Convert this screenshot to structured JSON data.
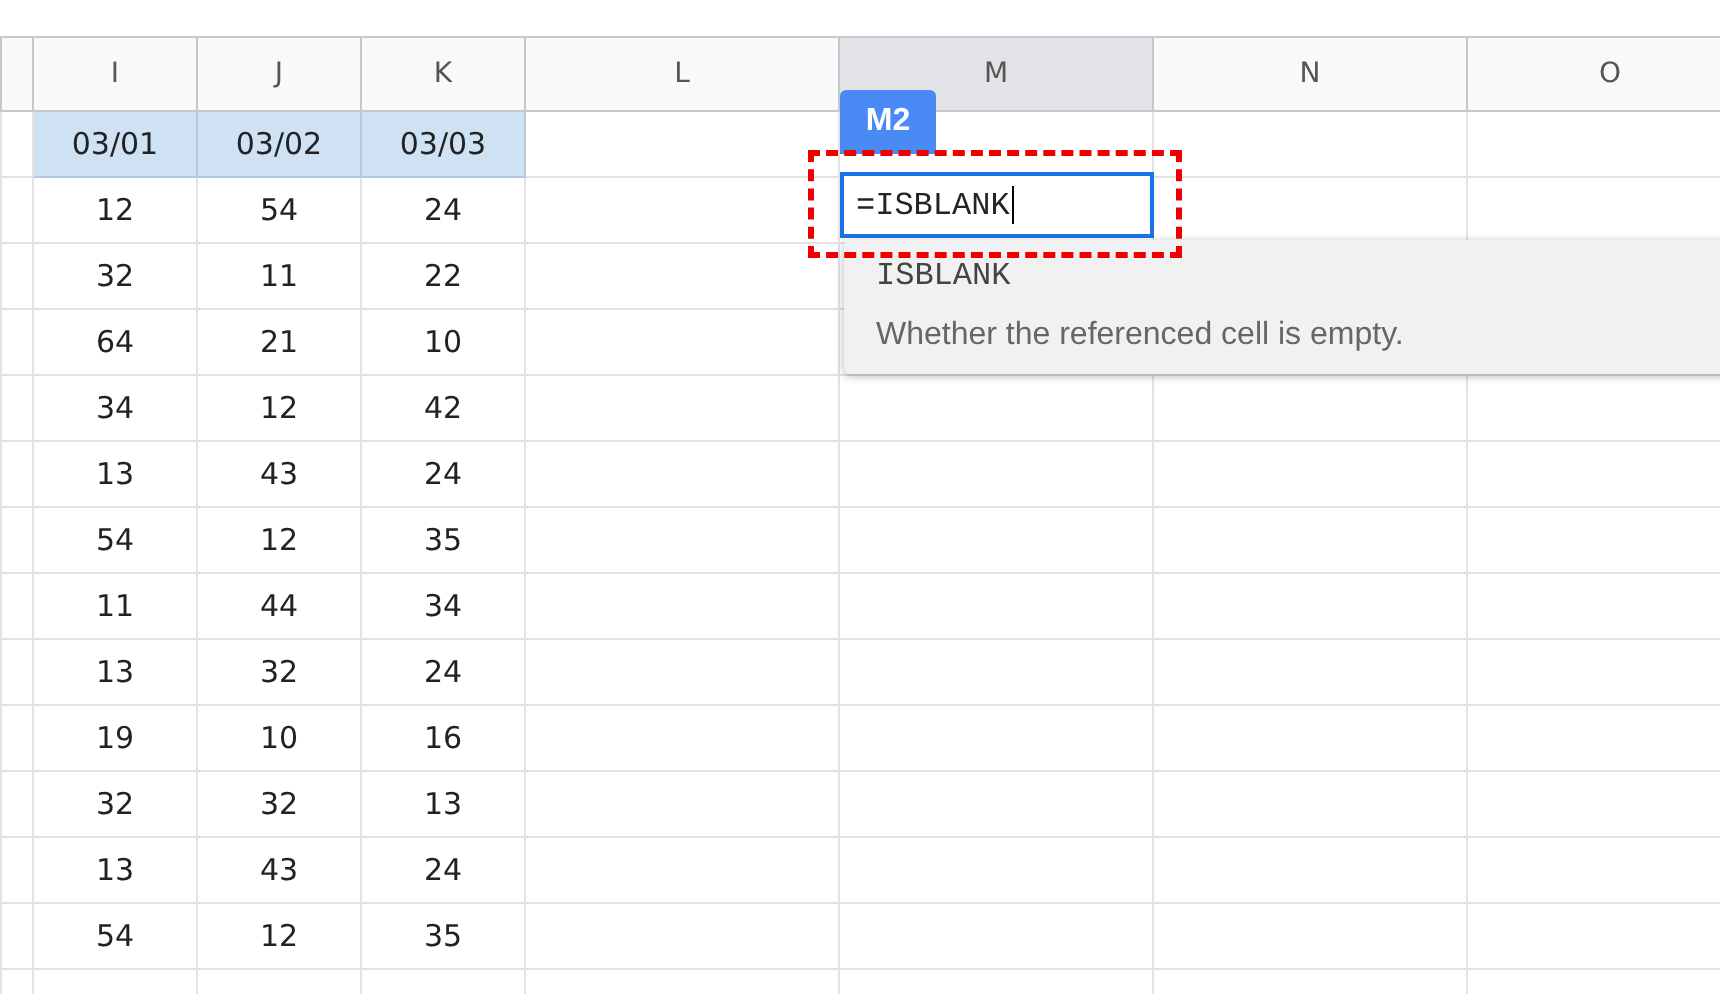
{
  "columns": [
    {
      "label": "I",
      "selected": false
    },
    {
      "label": "J",
      "selected": false
    },
    {
      "label": "K",
      "selected": false
    },
    {
      "label": "L",
      "selected": false
    },
    {
      "label": "M",
      "selected": true
    },
    {
      "label": "N",
      "selected": false
    },
    {
      "label": "O",
      "selected": false
    }
  ],
  "date_row": [
    "03/01",
    "03/02",
    "03/03"
  ],
  "rows": [
    [
      "12",
      "54",
      "24"
    ],
    [
      "32",
      "11",
      "22"
    ],
    [
      "64",
      "21",
      "10"
    ],
    [
      "34",
      "12",
      "42"
    ],
    [
      "13",
      "43",
      "24"
    ],
    [
      "54",
      "12",
      "35"
    ],
    [
      "11",
      "44",
      "34"
    ],
    [
      "13",
      "32",
      "24"
    ],
    [
      "19",
      "10",
      "16"
    ],
    [
      "32",
      "32",
      "13"
    ],
    [
      "13",
      "43",
      "24"
    ],
    [
      "54",
      "12",
      "35"
    ]
  ],
  "cell_editor": {
    "cell_ref": "M2",
    "value": "=ISBLANK"
  },
  "suggestion": {
    "name": "ISBLANK",
    "description": "Whether the referenced cell is empty."
  }
}
